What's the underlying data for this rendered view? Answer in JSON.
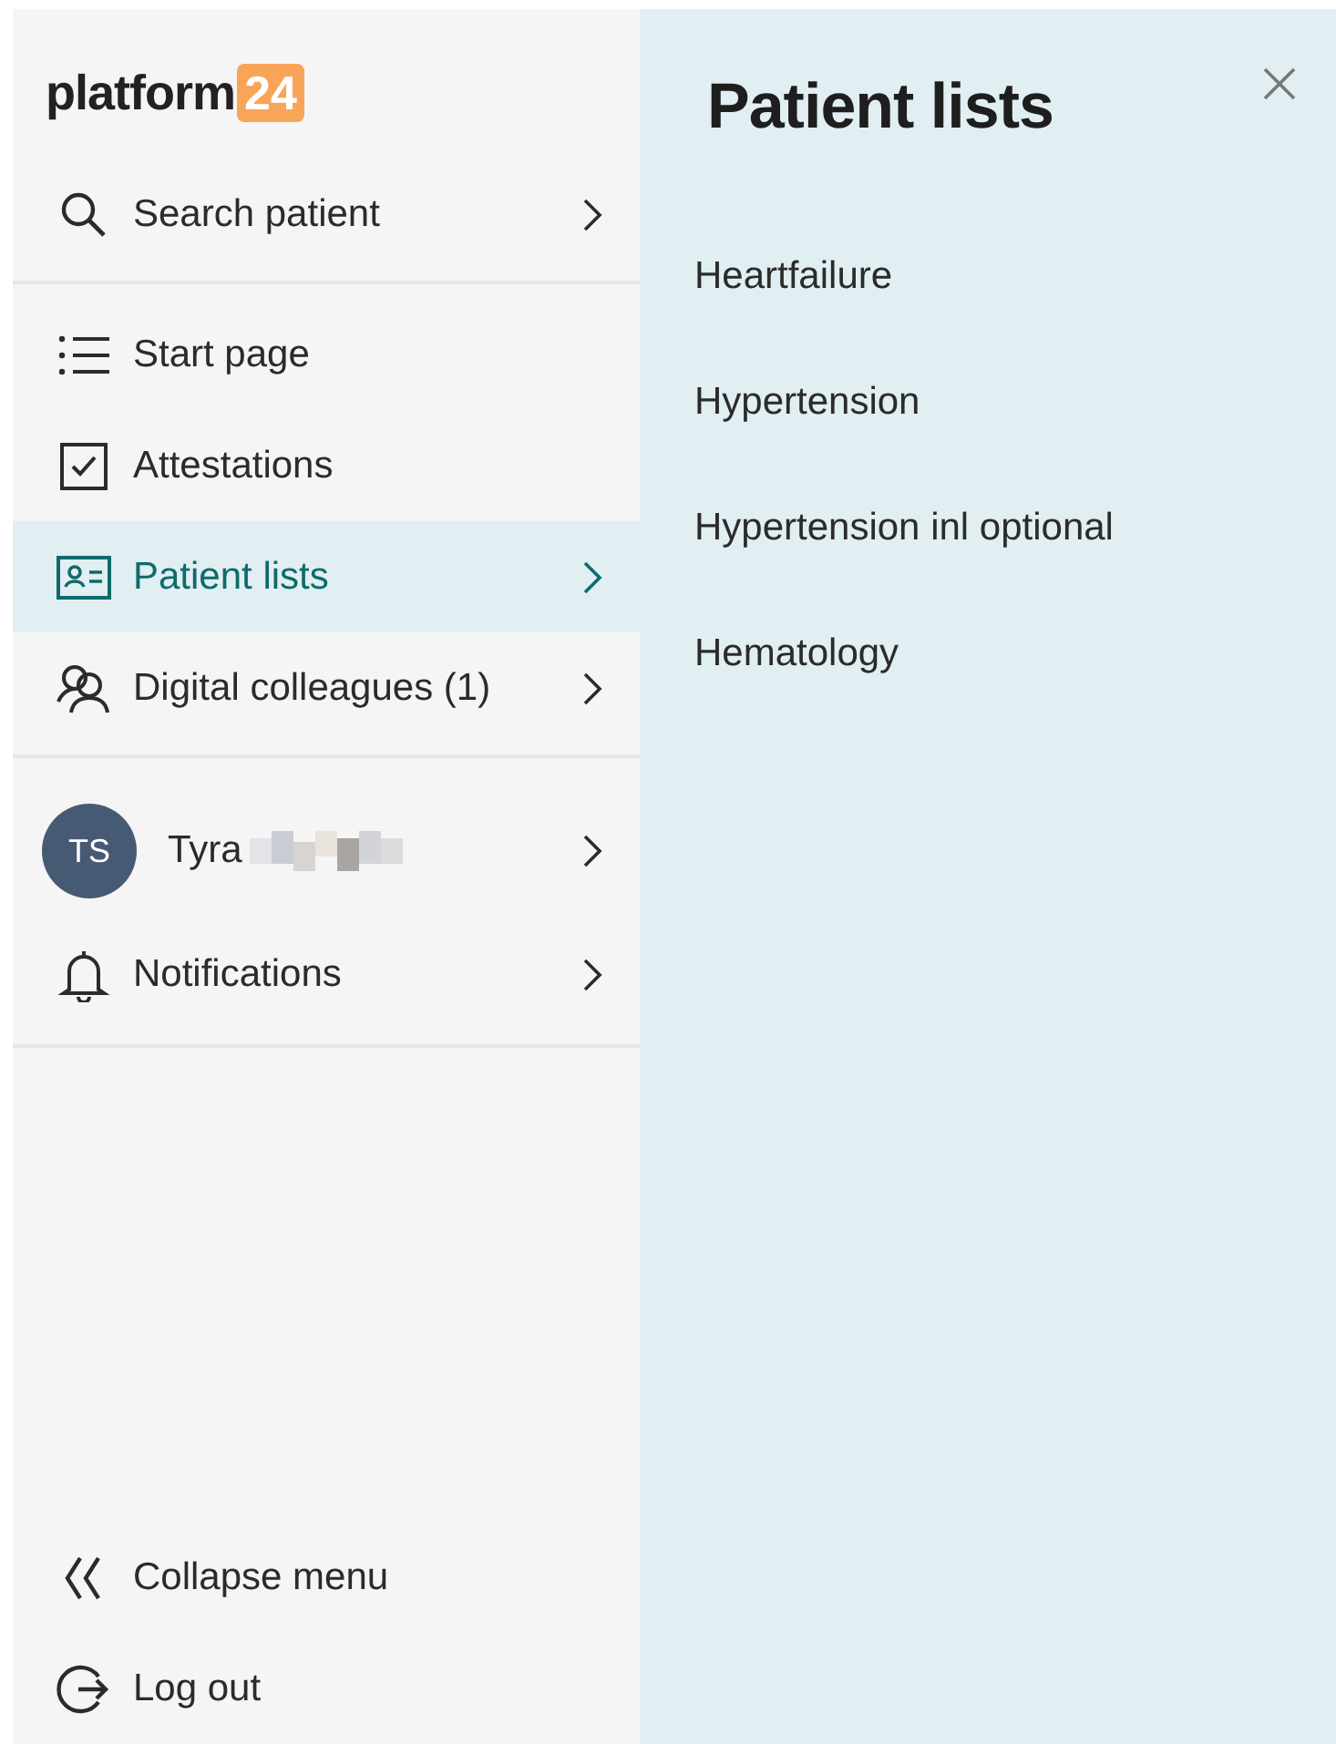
{
  "sidebar": {
    "logo": {
      "word": "platform",
      "badge": "24"
    },
    "search": {
      "label": "Search patient",
      "chevron": true
    },
    "nav": [
      {
        "label": "Start page",
        "kind": "list",
        "chevron": false,
        "selected": false
      },
      {
        "label": "Attestations",
        "kind": "checkbox",
        "chevron": false,
        "selected": false
      },
      {
        "label": "Patient lists",
        "kind": "card",
        "chevron": true,
        "selected": true
      },
      {
        "label": "Digital colleagues (1)",
        "kind": "people",
        "chevron": true,
        "selected": false
      }
    ],
    "account": [
      {
        "kind": "user",
        "initials": "TS",
        "label": "Tyra",
        "chevron": true
      },
      {
        "kind": "bell",
        "label": "Notifications",
        "chevron": true
      }
    ],
    "footer": [
      {
        "label": "Collapse menu",
        "kind": "double-chevron"
      },
      {
        "label": "Log out",
        "kind": "logout"
      }
    ]
  },
  "panel": {
    "title": "Patient lists",
    "items": [
      "Heartfailure",
      "Hypertension",
      "Hypertension inl optional",
      "Hematology"
    ]
  }
}
